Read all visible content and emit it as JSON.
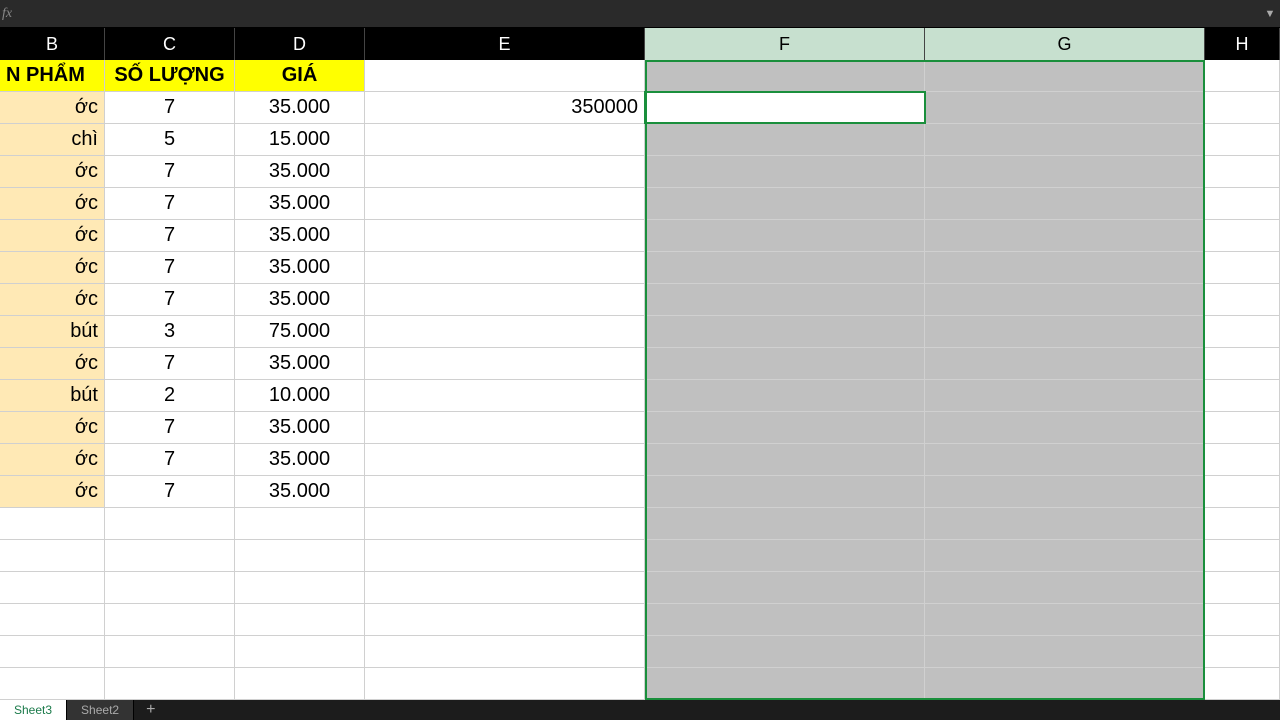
{
  "formula_bar": {
    "fx": "fx",
    "value": "",
    "dropdown_glyph": "▼"
  },
  "columns": [
    "B",
    "C",
    "D",
    "E",
    "F",
    "G",
    "H"
  ],
  "selected_columns": [
    "F",
    "G"
  ],
  "header_row": {
    "B": "N PHẨM",
    "C": "SỐ LƯỢNG",
    "D": "GIÁ"
  },
  "rows": [
    {
      "B": "ớc",
      "C": "7",
      "D": "35.000",
      "E": "350000"
    },
    {
      "B": "chì",
      "C": "5",
      "D": "15.000",
      "E": ""
    },
    {
      "B": "ớc",
      "C": "7",
      "D": "35.000",
      "E": ""
    },
    {
      "B": "ớc",
      "C": "7",
      "D": "35.000",
      "E": ""
    },
    {
      "B": "ớc",
      "C": "7",
      "D": "35.000",
      "E": ""
    },
    {
      "B": "ớc",
      "C": "7",
      "D": "35.000",
      "E": ""
    },
    {
      "B": "ớc",
      "C": "7",
      "D": "35.000",
      "E": ""
    },
    {
      "B": "bút",
      "C": "3",
      "D": "75.000",
      "E": ""
    },
    {
      "B": "ớc",
      "C": "7",
      "D": "35.000",
      "E": ""
    },
    {
      "B": "bút",
      "C": "2",
      "D": "10.000",
      "E": ""
    },
    {
      "B": "ớc",
      "C": "7",
      "D": "35.000",
      "E": ""
    },
    {
      "B": "ớc",
      "C": "7",
      "D": "35.000",
      "E": ""
    },
    {
      "B": "ớc",
      "C": "7",
      "D": "35.000",
      "E": ""
    }
  ],
  "empty_rows_after": 6,
  "active_cell": {
    "col": "F",
    "row_index": 0
  },
  "sheet_tabs": {
    "active": "Sheet3",
    "others": [
      "Sheet2"
    ],
    "add_glyph": "+"
  }
}
